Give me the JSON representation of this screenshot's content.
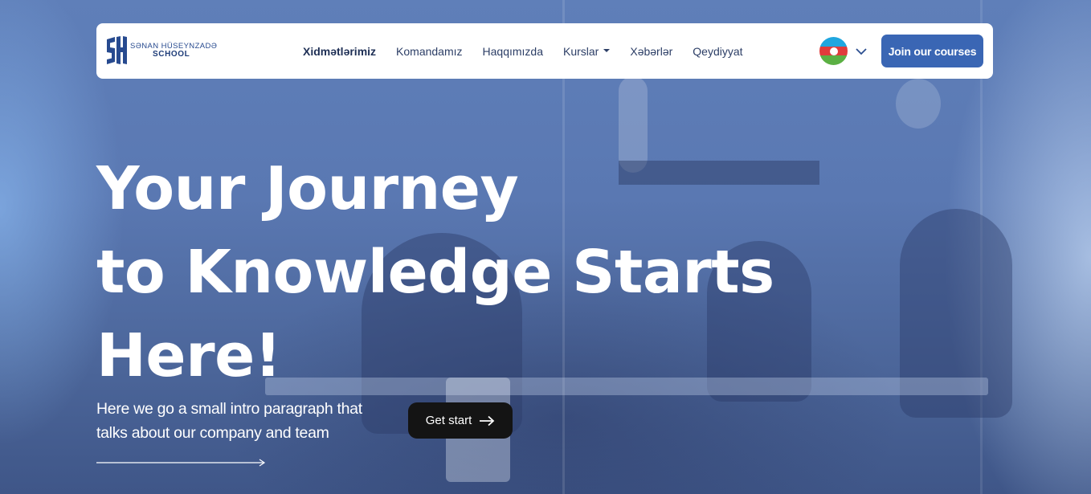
{
  "brand": {
    "line1": "SƏNAN HÜSEYNZADƏ",
    "line2": "SCHOOL",
    "logo_icon": "sh-monogram-logo"
  },
  "nav": {
    "items": [
      {
        "label": "Xidmətlərimiz",
        "active": true
      },
      {
        "label": "Komandamız",
        "active": false
      },
      {
        "label": "Haqqımızda",
        "active": false
      },
      {
        "label": "Kurslar",
        "active": false,
        "dropdown": true
      },
      {
        "label": "Xəbərlər",
        "active": false
      },
      {
        "label": "Qeydiyyat",
        "active": false
      }
    ],
    "language_icon": "azerbaijan-flag-icon",
    "language_toggle_icon": "chevron-down-icon",
    "join_label": "Join our courses"
  },
  "hero": {
    "headline_lines": [
      "Your Journey",
      "to Knowledge Starts",
      "Here!"
    ],
    "intro_lines": [
      "Here we go a small intro paragraph that",
      "talks about our company and team"
    ],
    "cta_label": "Get start",
    "cta_icon": "arrow-right-icon",
    "intro_icon": "long-arrow-right-icon"
  },
  "colors": {
    "accent": "#3a66b4",
    "brand_navy": "#274a8f",
    "cta_bg": "#141414",
    "flag_blue": "#1fa6df",
    "flag_red": "#e03b3b",
    "flag_green": "#5bb043"
  }
}
